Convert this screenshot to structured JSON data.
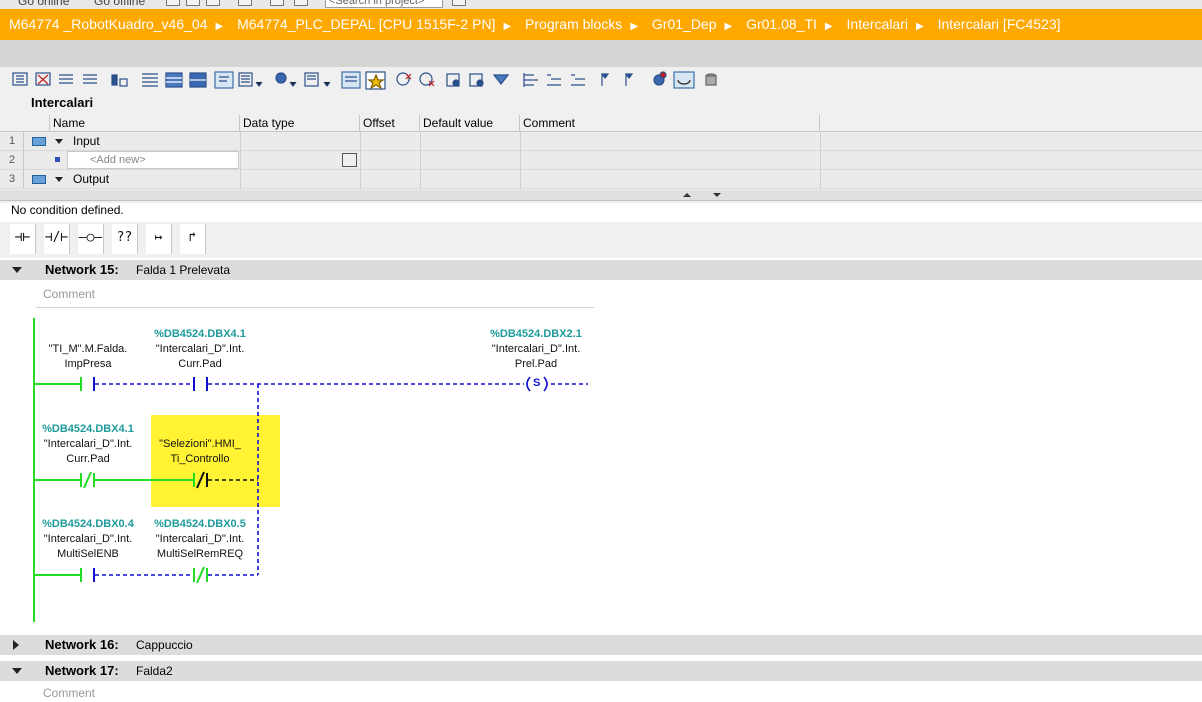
{
  "top_strip": {
    "go_online": "Go online",
    "go_offline": "Go offline",
    "search_placeholder": "<Search in project>"
  },
  "breadcrumb": [
    "M64774 _RobotKuadro_v46_04",
    "M64774_PLC_DEPAL [CPU 1515F-2 PN]",
    "Program blocks",
    "Gr01_Dep",
    "Gr01.08_TI",
    "Intercalari",
    "Intercalari [FC4523]"
  ],
  "interface": {
    "title": "Intercalari",
    "columns": [
      "Name",
      "Data type",
      "Offset",
      "Default value",
      "Comment"
    ],
    "rows": [
      {
        "num": "1",
        "name": "Input"
      },
      {
        "num": "2",
        "name": "<Add new>"
      },
      {
        "num": "3",
        "name": "Output"
      }
    ]
  },
  "no_condition": "No condition defined.",
  "ladder_toolbar": [
    "⊣⊢",
    "⊣/⊢",
    "–○–",
    "??",
    "↦",
    "↱"
  ],
  "networks": [
    {
      "label": "Network 15:",
      "title": "Falda 1 Prelevata",
      "comment": "Comment"
    },
    {
      "label": "Network 16:",
      "title": "Cappuccio"
    },
    {
      "label": "Network 17:",
      "title": "Falda2",
      "comment": "Comment"
    }
  ],
  "ladder": {
    "c1": {
      "addr": "",
      "line1": "\"TI_M\".M.Falda.",
      "line2": "ImpPresa"
    },
    "c2": {
      "addr": "%DB4524.DBX4.1",
      "line1": "\"Intercalari_D\".Int.",
      "line2": "Curr.Pad"
    },
    "coil": {
      "addr": "%DB4524.DBX2.1",
      "line1": "\"Intercalari_D\".Int.",
      "line2": "Prel.Pad",
      "symbol": "S"
    },
    "c3": {
      "addr": "%DB4524.DBX4.1",
      "line1": "\"Intercalari_D\".Int.",
      "line2": "Curr.Pad"
    },
    "c4": {
      "addr": "",
      "line1": "\"Selezioni\".HMI_",
      "line2": "Ti_Controllo"
    },
    "c5": {
      "addr": "%DB4524.DBX0.4",
      "line1": "\"Intercalari_D\".Int.",
      "line2": "MultiSelENB"
    },
    "c6": {
      "addr": "%DB4524.DBX0.5",
      "line1": "\"Intercalari_D\".Int.",
      "line2": "MultiSelRemREQ"
    }
  },
  "colors": {
    "breadcrumb_bg": "#ffa800",
    "power_flow": "#22dd22",
    "no_flow": "#1010d0",
    "highlight": "#fff000",
    "address": "#1e9b9b"
  }
}
